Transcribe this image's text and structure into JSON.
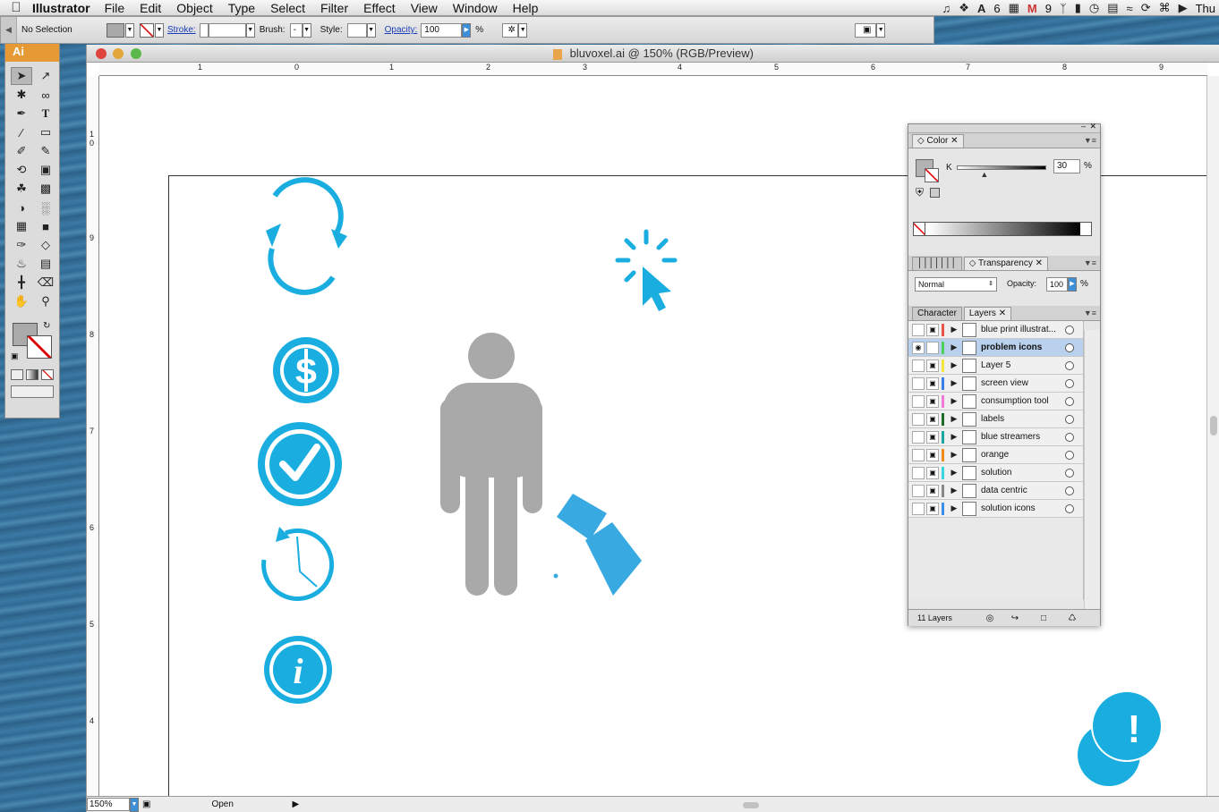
{
  "menubar": {
    "app_name": "Illustrator",
    "items": [
      "File",
      "Edit",
      "Object",
      "Type",
      "Select",
      "Filter",
      "Effect",
      "View",
      "Window",
      "Help"
    ],
    "status": {
      "adobe_count": "6",
      "gmail_count": "9",
      "clock": "Thu"
    }
  },
  "controlbar": {
    "selection": "No Selection",
    "stroke_label": "Stroke:",
    "brush_label": "Brush:",
    "brush_value": "-",
    "style_label": "Style:",
    "opacity_label": "Opacity:",
    "opacity_value": "100",
    "percent": "%"
  },
  "tools": {
    "app_badge": "Ai"
  },
  "document": {
    "title": "bluvoxel.ai @ 150% (RGB/Preview)",
    "zoom": "150%",
    "status_text": "Open",
    "hruler_numbers": [
      "1",
      "0",
      "1",
      "2",
      "3",
      "4",
      "5",
      "6",
      "7",
      "8",
      "9"
    ],
    "vruler_numbers": [
      "1",
      "0",
      "9",
      "8",
      "7",
      "6",
      "5",
      "4"
    ]
  },
  "color_panel": {
    "tab": "Color",
    "channel_label": "K",
    "k_value": "30",
    "k_fraction": 0.3,
    "percent": "%"
  },
  "transparency_panel": {
    "tab": "Transparency",
    "blend_mode": "Normal",
    "opacity_label": "Opacity:",
    "opacity_value": "100",
    "percent": "%"
  },
  "layers_panel": {
    "tabs": [
      "Character",
      "Layers"
    ],
    "active_tab": "Layers",
    "layers": [
      {
        "name": "blue print illustrat...",
        "color": "#e8534a",
        "visible": false,
        "selected": false
      },
      {
        "name": "problem icons",
        "color": "#4ed15a",
        "visible": true,
        "selected": true
      },
      {
        "name": "Layer 5",
        "color": "#f2e63a",
        "visible": false,
        "selected": false
      },
      {
        "name": "screen view",
        "color": "#3a7ee8",
        "visible": false,
        "selected": false
      },
      {
        "name": "consumption tool",
        "color": "#f07ad8",
        "visible": false,
        "selected": false
      },
      {
        "name": "labels",
        "color": "#1f6b2a",
        "visible": false,
        "selected": false
      },
      {
        "name": "blue streamers",
        "color": "#1aa7a0",
        "visible": false,
        "selected": false
      },
      {
        "name": "orange",
        "color": "#f08a1a",
        "visible": false,
        "selected": false
      },
      {
        "name": "solution",
        "color": "#39d6e0",
        "visible": false,
        "selected": false
      },
      {
        "name": "data centric",
        "color": "#888888",
        "visible": false,
        "selected": false
      },
      {
        "name": "solution icons",
        "color": "#3a8ee8",
        "visible": false,
        "selected": false
      }
    ],
    "count_label": "11 Layers"
  },
  "artwork": {
    "accent_color": "#1aaee0",
    "person_color": "#a9a9a9",
    "screen_color": "#39a9e1",
    "dollar_glyph": "S",
    "info_glyph": "i",
    "alert_glyph": "!"
  }
}
